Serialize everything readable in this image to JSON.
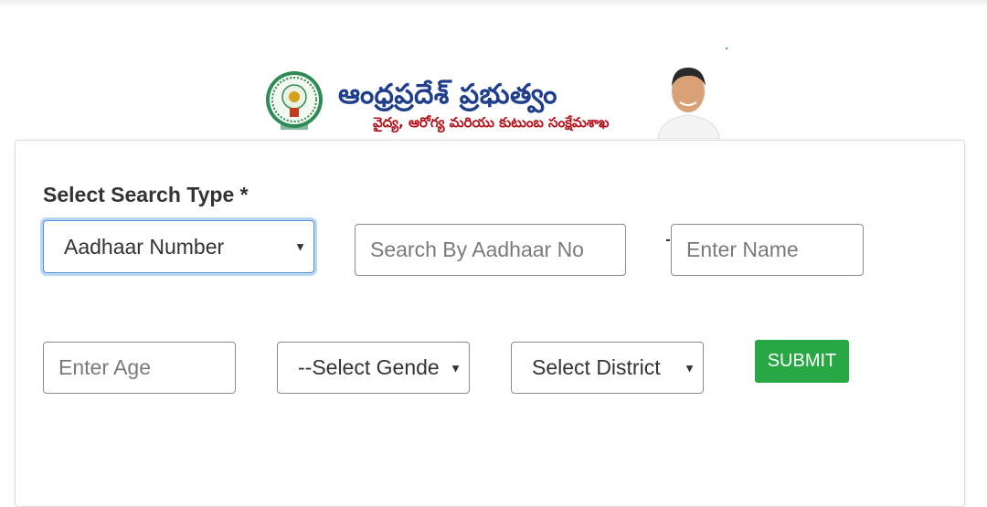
{
  "header": {
    "emblem_icon": "andhra-pradesh-emblem",
    "title": "ఆంధ్రప్రదేశ్ ప్రభుత్వం",
    "subtitle": "వైద్య, ఆరోగ్య మరియు కుటుంబ సంక్షేమశాఖ",
    "portrait_icon": "official-portrait"
  },
  "form": {
    "search_type_label": "Select Search Type *",
    "search_type_selected": "Aadhaar Number",
    "aadhaar_placeholder": "Search By Aadhaar No",
    "name_placeholder": "Enter Name",
    "age_placeholder": "Enter Age",
    "gender_selected": "--Select Gende",
    "district_selected": "Select District",
    "submit_label": "SUBMIT",
    "dropdown_icon": "caret-down-icon"
  },
  "colors": {
    "title": "#1f3f8c",
    "subtitle": "#b5121b",
    "submit": "#28a745",
    "focus_ring": "#b9d6f3"
  }
}
